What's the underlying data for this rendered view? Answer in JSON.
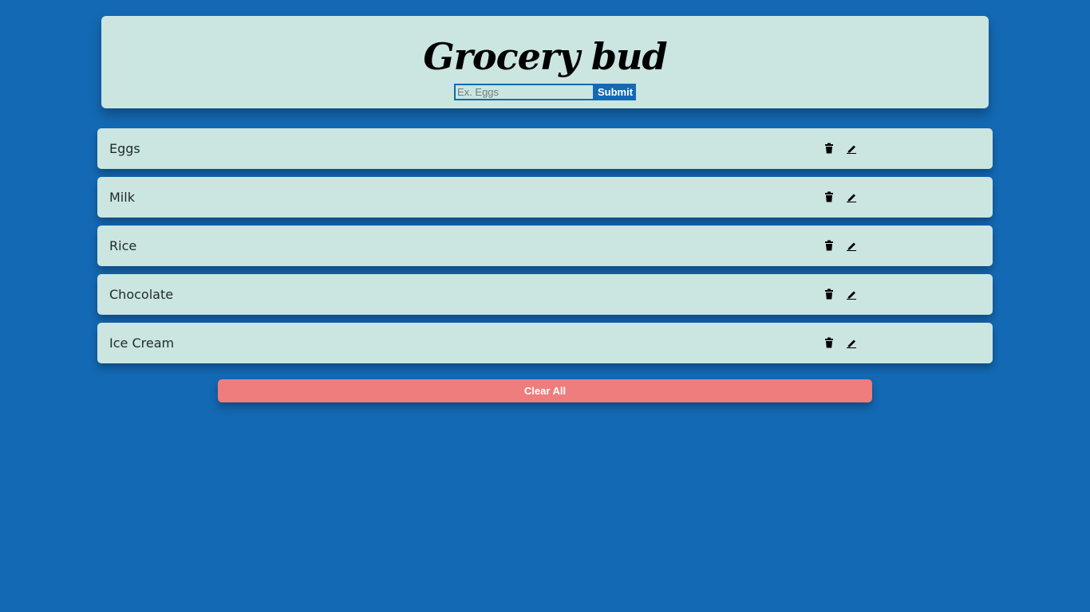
{
  "app": {
    "title": "Grocery bud"
  },
  "form": {
    "input_value": "",
    "input_placeholder": "Ex. Eggs",
    "submit_label": "Submit"
  },
  "items": [
    {
      "name": "Eggs"
    },
    {
      "name": "Milk"
    },
    {
      "name": "Rice"
    },
    {
      "name": "Chocolate"
    },
    {
      "name": "Ice Cream"
    }
  ],
  "icons": {
    "delete": "trash-icon",
    "edit": "pencil-icon"
  },
  "actions": {
    "clear_all_label": "Clear All"
  },
  "colors": {
    "background": "#1369b4",
    "card": "#cbe5e1",
    "accent": "#1369b4",
    "clear_button": "#ef7d7d"
  }
}
